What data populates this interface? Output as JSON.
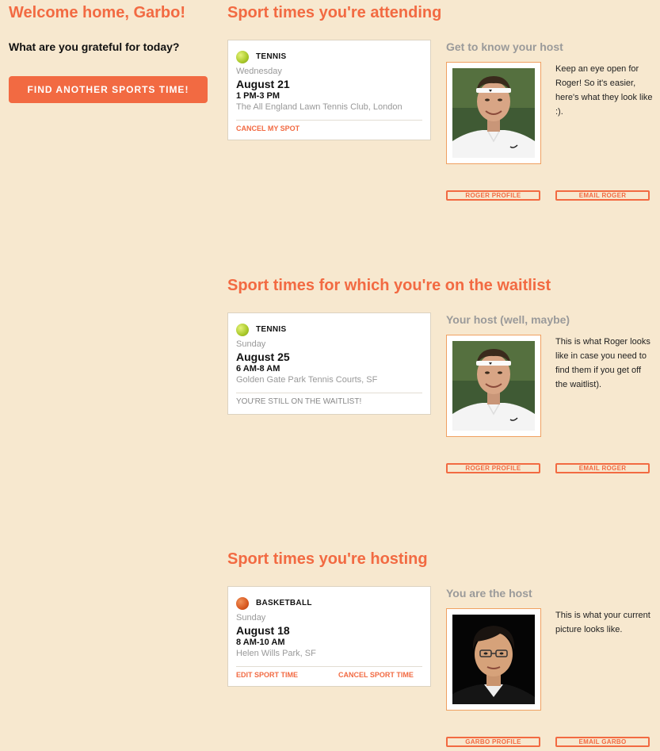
{
  "left": {
    "welcome": "Welcome home, Garbo!",
    "prompt": "What are you grateful for today?",
    "find_button": "FIND ANOTHER SPORTS TIME!"
  },
  "sections": {
    "attending": {
      "title": "Sport times you're attending",
      "card": {
        "sport": "TENNIS",
        "day": "Wednesday",
        "date": "August 21",
        "time": "1 PM-3 PM",
        "place": "The All England Lawn Tennis Club, London",
        "action": "CANCEL MY SPOT"
      },
      "host": {
        "heading": "Get to know your host",
        "text": "Keep an eye open for Roger! So it's easier, here's what they look like :).",
        "profile_button": "ROGER PROFILE",
        "email_button": "EMAIL ROGER"
      }
    },
    "waitlist": {
      "title": "Sport times for which you're on the waitlist",
      "card": {
        "sport": "TENNIS",
        "day": "Sunday",
        "date": "August 25",
        "time": "6 AM-8 AM",
        "place": "Golden Gate Park Tennis Courts, SF",
        "note": "YOU'RE STILL ON THE WAITLIST!"
      },
      "host": {
        "heading": "Your host (well, maybe)",
        "text": "This is what Roger looks like in case you need to find them if you get off the waitlist).",
        "profile_button": "ROGER PROFILE",
        "email_button": "EMAIL ROGER"
      }
    },
    "hosting": {
      "title": "Sport times you're hosting",
      "card": {
        "sport": "BASKETBALL",
        "day": "Sunday",
        "date": "August 18",
        "time": "8 AM-10 AM",
        "place": "Helen Wills Park, SF",
        "edit": "EDIT SPORT TIME",
        "cancel": "CANCEL SPORT TIME"
      },
      "host": {
        "heading": "You are the host",
        "text": "This is what your current picture looks like.",
        "profile_button": "GARBO PROFILE",
        "email_button": "EMAIL GARBO"
      }
    }
  },
  "icons": {
    "tennis": "tennis-ball-icon",
    "basketball": "basketball-icon"
  },
  "colors": {
    "accent": "#f26a42",
    "background": "#f7e8cf",
    "muted": "#9a9a9a"
  }
}
